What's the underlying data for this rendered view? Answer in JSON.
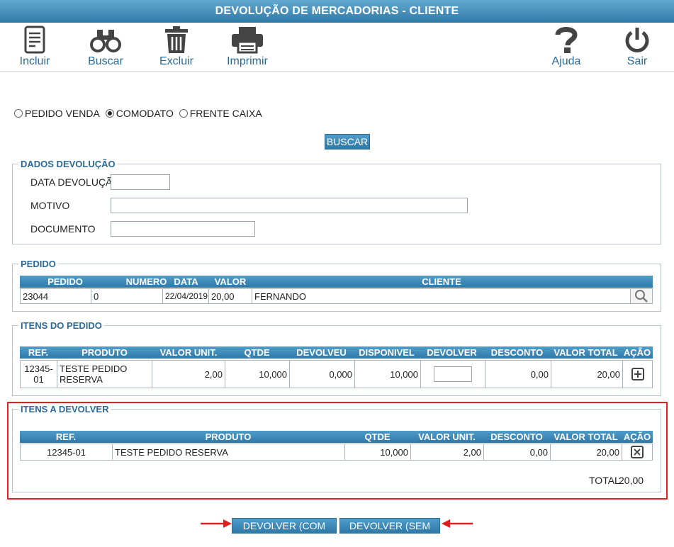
{
  "window": {
    "title": "DEVOLUÇÃO DE MERCADORIAS - CLIENTE"
  },
  "toolbar": {
    "incluir": "Incluir",
    "buscar": "Buscar",
    "excluir": "Excluir",
    "imprimir": "Imprimir",
    "ajuda": "Ajuda",
    "sair": "Sair"
  },
  "tipo": {
    "options": [
      "PEDIDO VENDA",
      "COMODATO",
      "FRENTE CAIXA"
    ],
    "selected": "COMODATO"
  },
  "buscar_button": "BUSCAR",
  "dados": {
    "legend": "DADOS DEVOLUÇÃO",
    "data_label": "DATA DEVOLUÇÃO",
    "motivo_label": "MOTIVO",
    "documento_label": "DOCUMENTO",
    "data_value": "",
    "motivo_value": "",
    "documento_value": ""
  },
  "pedido": {
    "legend": "PEDIDO",
    "headers": [
      "PEDIDO",
      "NUMERO",
      "DATA",
      "VALOR",
      "CLIENTE"
    ],
    "row": {
      "pedido": "23044",
      "numero": "0",
      "data": "22/04/2019",
      "valor": "20,00",
      "cliente": "FERNANDO"
    }
  },
  "itens_pedido": {
    "legend": "ITENS DO PEDIDO",
    "headers": [
      "REF.",
      "PRODUTO",
      "VALOR UNIT.",
      "QTDE",
      "DEVOLVEU",
      "DISPONIVEL",
      "DEVOLVER",
      "DESCONTO",
      "VALOR TOTAL",
      "AÇÃO"
    ],
    "row": {
      "ref": "12345-01",
      "produto": "TESTE PEDIDO RESERVA",
      "valor_unit": "2,00",
      "qtde": "10,000",
      "devolveu": "0,000",
      "disponivel": "10,000",
      "devolver": "",
      "desconto": "0,00",
      "valor_total": "20,00"
    }
  },
  "itens_devolver": {
    "legend": "ITENS A DEVOLVER",
    "headers": [
      "REF.",
      "PRODUTO",
      "QTDE",
      "VALOR UNIT.",
      "DESCONTO",
      "VALOR TOTAL",
      "AÇÃO"
    ],
    "row": {
      "ref": "12345-01",
      "produto": "TESTE PEDIDO RESERVA",
      "qtde": "10,000",
      "valor_unit": "2,00",
      "desconto": "0,00",
      "valor_total": "20,00"
    },
    "total_label": "TOTAL",
    "total_value": "20,00"
  },
  "actions": {
    "com_nfe": "DEVOLVER (COM NFE)",
    "sem_nfe": "DEVOLVER (SEM NFE)"
  },
  "colors": {
    "header_blue": "#2f79a9",
    "label_blue": "#2b6a96",
    "highlight_red": "#e02020"
  }
}
